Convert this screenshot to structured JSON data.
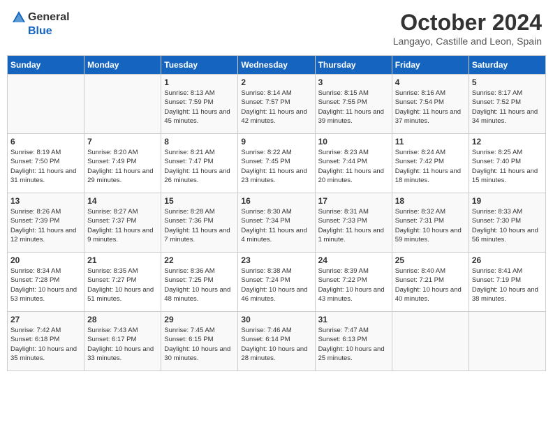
{
  "header": {
    "logo_general": "General",
    "logo_blue": "Blue",
    "month_title": "October 2024",
    "location": "Langayo, Castille and Leon, Spain"
  },
  "days_of_week": [
    "Sunday",
    "Monday",
    "Tuesday",
    "Wednesday",
    "Thursday",
    "Friday",
    "Saturday"
  ],
  "weeks": [
    [
      {
        "day": "",
        "info": ""
      },
      {
        "day": "",
        "info": ""
      },
      {
        "day": "1",
        "info": "Sunrise: 8:13 AM\nSunset: 7:59 PM\nDaylight: 11 hours and 45 minutes."
      },
      {
        "day": "2",
        "info": "Sunrise: 8:14 AM\nSunset: 7:57 PM\nDaylight: 11 hours and 42 minutes."
      },
      {
        "day": "3",
        "info": "Sunrise: 8:15 AM\nSunset: 7:55 PM\nDaylight: 11 hours and 39 minutes."
      },
      {
        "day": "4",
        "info": "Sunrise: 8:16 AM\nSunset: 7:54 PM\nDaylight: 11 hours and 37 minutes."
      },
      {
        "day": "5",
        "info": "Sunrise: 8:17 AM\nSunset: 7:52 PM\nDaylight: 11 hours and 34 minutes."
      }
    ],
    [
      {
        "day": "6",
        "info": "Sunrise: 8:19 AM\nSunset: 7:50 PM\nDaylight: 11 hours and 31 minutes."
      },
      {
        "day": "7",
        "info": "Sunrise: 8:20 AM\nSunset: 7:49 PM\nDaylight: 11 hours and 29 minutes."
      },
      {
        "day": "8",
        "info": "Sunrise: 8:21 AM\nSunset: 7:47 PM\nDaylight: 11 hours and 26 minutes."
      },
      {
        "day": "9",
        "info": "Sunrise: 8:22 AM\nSunset: 7:45 PM\nDaylight: 11 hours and 23 minutes."
      },
      {
        "day": "10",
        "info": "Sunrise: 8:23 AM\nSunset: 7:44 PM\nDaylight: 11 hours and 20 minutes."
      },
      {
        "day": "11",
        "info": "Sunrise: 8:24 AM\nSunset: 7:42 PM\nDaylight: 11 hours and 18 minutes."
      },
      {
        "day": "12",
        "info": "Sunrise: 8:25 AM\nSunset: 7:40 PM\nDaylight: 11 hours and 15 minutes."
      }
    ],
    [
      {
        "day": "13",
        "info": "Sunrise: 8:26 AM\nSunset: 7:39 PM\nDaylight: 11 hours and 12 minutes."
      },
      {
        "day": "14",
        "info": "Sunrise: 8:27 AM\nSunset: 7:37 PM\nDaylight: 11 hours and 9 minutes."
      },
      {
        "day": "15",
        "info": "Sunrise: 8:28 AM\nSunset: 7:36 PM\nDaylight: 11 hours and 7 minutes."
      },
      {
        "day": "16",
        "info": "Sunrise: 8:30 AM\nSunset: 7:34 PM\nDaylight: 11 hours and 4 minutes."
      },
      {
        "day": "17",
        "info": "Sunrise: 8:31 AM\nSunset: 7:33 PM\nDaylight: 11 hours and 1 minute."
      },
      {
        "day": "18",
        "info": "Sunrise: 8:32 AM\nSunset: 7:31 PM\nDaylight: 10 hours and 59 minutes."
      },
      {
        "day": "19",
        "info": "Sunrise: 8:33 AM\nSunset: 7:30 PM\nDaylight: 10 hours and 56 minutes."
      }
    ],
    [
      {
        "day": "20",
        "info": "Sunrise: 8:34 AM\nSunset: 7:28 PM\nDaylight: 10 hours and 53 minutes."
      },
      {
        "day": "21",
        "info": "Sunrise: 8:35 AM\nSunset: 7:27 PM\nDaylight: 10 hours and 51 minutes."
      },
      {
        "day": "22",
        "info": "Sunrise: 8:36 AM\nSunset: 7:25 PM\nDaylight: 10 hours and 48 minutes."
      },
      {
        "day": "23",
        "info": "Sunrise: 8:38 AM\nSunset: 7:24 PM\nDaylight: 10 hours and 46 minutes."
      },
      {
        "day": "24",
        "info": "Sunrise: 8:39 AM\nSunset: 7:22 PM\nDaylight: 10 hours and 43 minutes."
      },
      {
        "day": "25",
        "info": "Sunrise: 8:40 AM\nSunset: 7:21 PM\nDaylight: 10 hours and 40 minutes."
      },
      {
        "day": "26",
        "info": "Sunrise: 8:41 AM\nSunset: 7:19 PM\nDaylight: 10 hours and 38 minutes."
      }
    ],
    [
      {
        "day": "27",
        "info": "Sunrise: 7:42 AM\nSunset: 6:18 PM\nDaylight: 10 hours and 35 minutes."
      },
      {
        "day": "28",
        "info": "Sunrise: 7:43 AM\nSunset: 6:17 PM\nDaylight: 10 hours and 33 minutes."
      },
      {
        "day": "29",
        "info": "Sunrise: 7:45 AM\nSunset: 6:15 PM\nDaylight: 10 hours and 30 minutes."
      },
      {
        "day": "30",
        "info": "Sunrise: 7:46 AM\nSunset: 6:14 PM\nDaylight: 10 hours and 28 minutes."
      },
      {
        "day": "31",
        "info": "Sunrise: 7:47 AM\nSunset: 6:13 PM\nDaylight: 10 hours and 25 minutes."
      },
      {
        "day": "",
        "info": ""
      },
      {
        "day": "",
        "info": ""
      }
    ]
  ]
}
